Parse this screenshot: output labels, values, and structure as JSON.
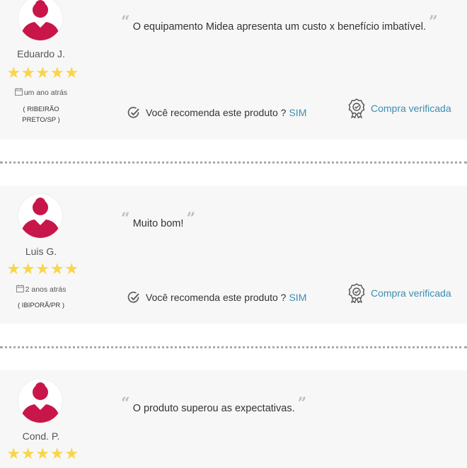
{
  "reviews": [
    {
      "name": "Eduardo J.",
      "stars": 5,
      "date": "um ano atrás",
      "location": "( RIBEIRÃO PRETO/SP )",
      "quote": "O equipamento Midea apresenta um custo x benefício imbatível.",
      "recommend_label": "Você recomenda este produto ?",
      "recommend_value": "SIM",
      "verified_label": "Compra verificada"
    },
    {
      "name": "Luis G.",
      "stars": 5,
      "date": "2 anos atrás",
      "location": "( IBIPORÃ/PR )",
      "quote": "Muito bom!",
      "recommend_label": "Você recomenda este produto ?",
      "recommend_value": "SIM",
      "verified_label": "Compra verificada"
    },
    {
      "name": "Cond. P.",
      "stars": 5,
      "quote": "O produto superou as expectativas."
    }
  ],
  "quote_open": "“",
  "quote_close": "”",
  "colors": {
    "avatar": "#c8164a",
    "star": "#f9d54a",
    "link": "#3b8db1",
    "panel": "#f7f7f7"
  },
  "icons": {
    "avatar": "user-avatar-icon",
    "star": "star-icon",
    "calendar": "calendar-icon",
    "check": "check-circle-icon",
    "badge": "verified-badge-icon"
  }
}
